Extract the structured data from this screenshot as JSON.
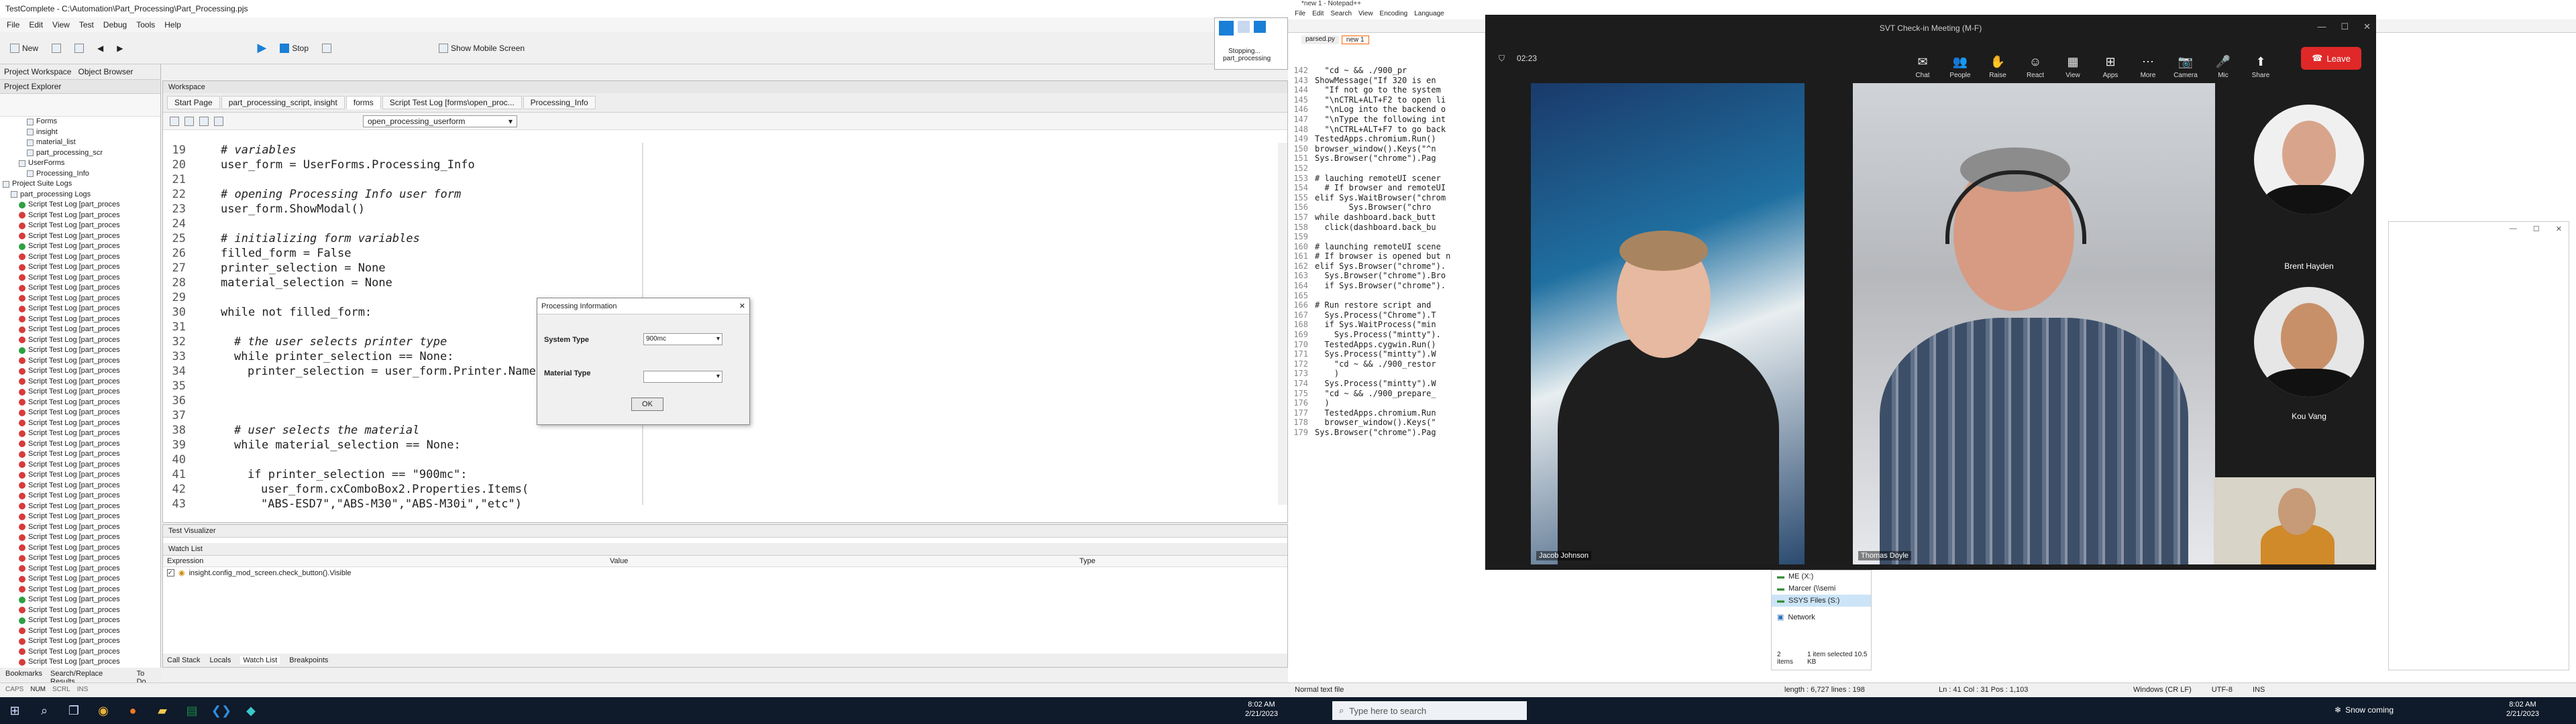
{
  "testcomplete": {
    "title": "TestComplete - C:\\Automation\\Part_Processing\\Part_Processing.pjs",
    "menu": [
      "File",
      "Edit",
      "View",
      "Test",
      "Debug",
      "Tools",
      "Help"
    ],
    "toolbar": {
      "new": "New",
      "run": "Run",
      "stop": "Stop",
      "show_mobile": "Show Mobile Screen"
    },
    "recording_badge": {
      "line1": "Stopping...",
      "line2": "part_processing"
    },
    "left_tabs": [
      "Project Workspace",
      "Object Browser"
    ],
    "project_explorer_title": "Project Explorer",
    "tree": [
      {
        "label": "Forms",
        "indent": 3,
        "status": "folder"
      },
      {
        "label": "insight",
        "indent": 3,
        "status": "folder"
      },
      {
        "label": "material_list",
        "indent": 3,
        "status": "folder"
      },
      {
        "label": "part_processing_scr",
        "indent": 3,
        "status": "folder"
      },
      {
        "label": "UserForms",
        "indent": 2,
        "status": "folder"
      },
      {
        "label": "Processing_Info",
        "indent": 3,
        "status": "folder"
      },
      {
        "label": "Project Suite Logs",
        "indent": 0,
        "status": "folder"
      },
      {
        "label": "part_processing Logs",
        "indent": 1,
        "status": "folder"
      },
      {
        "label": "Script Test Log [part_proces",
        "indent": 2,
        "status": "ok"
      },
      {
        "label": "Script Test Log [part_proces",
        "indent": 2,
        "status": "fail"
      },
      {
        "label": "Script Test Log [part_proces",
        "indent": 2,
        "status": "fail"
      },
      {
        "label": "Script Test Log [part_proces",
        "indent": 2,
        "status": "fail"
      },
      {
        "label": "Script Test Log [part_proces",
        "indent": 2,
        "status": "ok"
      },
      {
        "label": "Script Test Log [part_proces",
        "indent": 2,
        "status": "fail"
      },
      {
        "label": "Script Test Log [part_proces",
        "indent": 2,
        "status": "fail"
      },
      {
        "label": "Script Test Log [part_proces",
        "indent": 2,
        "status": "fail"
      },
      {
        "label": "Script Test Log [part_proces",
        "indent": 2,
        "status": "fail"
      },
      {
        "label": "Script Test Log [part_proces",
        "indent": 2,
        "status": "fail"
      },
      {
        "label": "Script Test Log [part_proces",
        "indent": 2,
        "status": "fail"
      },
      {
        "label": "Script Test Log [part_proces",
        "indent": 2,
        "status": "fail"
      },
      {
        "label": "Script Test Log [part_proces",
        "indent": 2,
        "status": "fail"
      },
      {
        "label": "Script Test Log [part_proces",
        "indent": 2,
        "status": "fail"
      },
      {
        "label": "Script Test Log [part_proces",
        "indent": 2,
        "status": "ok"
      },
      {
        "label": "Script Test Log [part_proces",
        "indent": 2,
        "status": "fail"
      },
      {
        "label": "Script Test Log [part_proces",
        "indent": 2,
        "status": "fail"
      },
      {
        "label": "Script Test Log [part_proces",
        "indent": 2,
        "status": "fail"
      },
      {
        "label": "Script Test Log [part_proces",
        "indent": 2,
        "status": "fail"
      },
      {
        "label": "Script Test Log [part_proces",
        "indent": 2,
        "status": "fail"
      },
      {
        "label": "Script Test Log [part_proces",
        "indent": 2,
        "status": "fail"
      },
      {
        "label": "Script Test Log [part_proces",
        "indent": 2,
        "status": "fail"
      },
      {
        "label": "Script Test Log [part_proces",
        "indent": 2,
        "status": "fail"
      },
      {
        "label": "Script Test Log [part_proces",
        "indent": 2,
        "status": "fail"
      },
      {
        "label": "Script Test Log [part_proces",
        "indent": 2,
        "status": "fail"
      },
      {
        "label": "Script Test Log [part_proces",
        "indent": 2,
        "status": "fail"
      },
      {
        "label": "Script Test Log [part_proces",
        "indent": 2,
        "status": "fail"
      },
      {
        "label": "Script Test Log [part_proces",
        "indent": 2,
        "status": "fail"
      },
      {
        "label": "Script Test Log [part_proces",
        "indent": 2,
        "status": "fail"
      },
      {
        "label": "Script Test Log [part_proces",
        "indent": 2,
        "status": "fail"
      },
      {
        "label": "Script Test Log [part_proces",
        "indent": 2,
        "status": "fail"
      },
      {
        "label": "Script Test Log [part_proces",
        "indent": 2,
        "status": "fail"
      },
      {
        "label": "Script Test Log [part_proces",
        "indent": 2,
        "status": "fail"
      },
      {
        "label": "Script Test Log [part_proces",
        "indent": 2,
        "status": "fail"
      },
      {
        "label": "Script Test Log [part_proces",
        "indent": 2,
        "status": "fail"
      },
      {
        "label": "Script Test Log [part_proces",
        "indent": 2,
        "status": "fail"
      },
      {
        "label": "Script Test Log [part_proces",
        "indent": 2,
        "status": "fail"
      },
      {
        "label": "Script Test Log [part_proces",
        "indent": 2,
        "status": "fail"
      },
      {
        "label": "Script Test Log [part_proces",
        "indent": 2,
        "status": "ok"
      },
      {
        "label": "Script Test Log [part_proces",
        "indent": 2,
        "status": "fail"
      },
      {
        "label": "Script Test Log [part_proces",
        "indent": 2,
        "status": "ok"
      },
      {
        "label": "Script Test Log [part_proces",
        "indent": 2,
        "status": "fail"
      },
      {
        "label": "Script Test Log [part_proces",
        "indent": 2,
        "status": "fail"
      },
      {
        "label": "Script Test Log [part_proces",
        "indent": 2,
        "status": "fail"
      },
      {
        "label": "Script Test Log [part_proces",
        "indent": 2,
        "status": "fail"
      },
      {
        "label": "Script Test Log [part_proces",
        "indent": 2,
        "status": "fail"
      }
    ],
    "workspace_title": "Workspace",
    "workspace_tabs": [
      "Start Page",
      "part_processing_script, insight",
      "forms",
      "Script Test Log [forms\\open_proc...",
      "Processing_Info"
    ],
    "active_tab": 2,
    "function_dropdown": "open_processing_userform",
    "code_lines": [
      {
        "n": "19",
        "t": "# variables",
        "c": "cm",
        "i": 0
      },
      {
        "n": "20",
        "t": "user_form = UserForms.Processing_Info",
        "c": "",
        "i": 0
      },
      {
        "n": "21",
        "t": "",
        "c": "",
        "i": 0
      },
      {
        "n": "22",
        "t": "# opening Processing Info user form",
        "c": "cm",
        "i": 0
      },
      {
        "n": "23",
        "t": "user_form.ShowModal()",
        "c": "",
        "i": 0
      },
      {
        "n": "24",
        "t": "",
        "c": "",
        "i": 0
      },
      {
        "n": "25",
        "t": "# initializing form variables",
        "c": "cm",
        "i": 0
      },
      {
        "n": "26",
        "t": "filled_form = False",
        "c": "",
        "i": 0
      },
      {
        "n": "27",
        "t": "printer_selection = None",
        "c": "",
        "i": 0
      },
      {
        "n": "28",
        "t": "material_selection = None",
        "c": "",
        "i": 0
      },
      {
        "n": "29",
        "t": "",
        "c": "",
        "i": 0
      },
      {
        "n": "30",
        "t": "while not filled_form:",
        "c": "kw",
        "i": 0
      },
      {
        "n": "31",
        "t": "",
        "c": "",
        "i": 0
      },
      {
        "n": "32",
        "t": "# the user selects printer type",
        "c": "cm",
        "i": 1
      },
      {
        "n": "33",
        "t": "while printer_selection == None:",
        "c": "kw",
        "i": 1
      },
      {
        "n": "34",
        "t": "printer_selection = user_form.Printer.Name",
        "c": "",
        "i": 2
      },
      {
        "n": "35",
        "t": "",
        "c": "",
        "i": 0
      },
      {
        "n": "36",
        "t": "",
        "c": "",
        "i": 0
      },
      {
        "n": "37",
        "t": "",
        "c": "",
        "i": 0
      },
      {
        "n": "38",
        "t": "# user selects the material",
        "c": "cm",
        "i": 1
      },
      {
        "n": "39",
        "t": "while material_selection == None:",
        "c": "kw",
        "i": 1
      },
      {
        "n": "40",
        "t": "",
        "c": "",
        "i": 0
      },
      {
        "n": "41",
        "t": "if printer_selection == \"900mc\":",
        "c": "kw",
        "i": 2
      },
      {
        "n": "42",
        "t": "user_form.cxComboBox2.Properties.Items(",
        "c": "",
        "i": 3
      },
      {
        "n": "43",
        "t": "\"ABS-ESD7\",\"ABS-M30\",\"ABS-M30i\",\"etc\")",
        "c": "st",
        "i": 3
      }
    ],
    "dialog": {
      "title": "Processing Information",
      "system_type_label": "System Type",
      "system_type_value": "900mc",
      "material_type_label": "Material Type",
      "material_type_value": "",
      "ok": "OK"
    },
    "test_visualizer": "Test Visualizer",
    "watch_title": "Watch List",
    "watch_cols": [
      "Expression",
      "Value",
      "Type"
    ],
    "watch_rows": [
      {
        "expr": "insight.config_mod_screen.check_button().Visible",
        "value": "",
        "type": ""
      }
    ],
    "bottom_tabs": [
      "Call Stack",
      "Locals",
      "Watch List",
      "Breakpoints"
    ],
    "footer_tabs": [
      "Bookmarks",
      "Search/Replace Results",
      "To Do"
    ],
    "status": [
      "CAPS",
      "NUM",
      "SCRL",
      "INS"
    ]
  },
  "notepad": {
    "title": "*new 1 - Notepad++",
    "menu": [
      "File",
      "Edit",
      "Search",
      "View",
      "Encoding",
      "Language"
    ],
    "tabs": [
      "parsed.py",
      "new 1"
    ],
    "code": [
      {
        "n": "142",
        "t": "  \"cd ~ && ./900_pr"
      },
      {
        "n": "143",
        "t": "ShowMessage(\"If 320 is en"
      },
      {
        "n": "144",
        "t": "  \"If not go to the system"
      },
      {
        "n": "145",
        "t": "  \"\\nCTRL+ALT+F2 to open li"
      },
      {
        "n": "146",
        "t": "  \"\\nLog into the backend o"
      },
      {
        "n": "147",
        "t": "  \"\\nType the following int"
      },
      {
        "n": "148",
        "t": "  \"\\nCTRL+ALT+F7 to go back"
      },
      {
        "n": "149",
        "t": "TestedApps.chromium.Run()"
      },
      {
        "n": "150",
        "t": "browser_window().Keys(\"^n"
      },
      {
        "n": "151",
        "t": "Sys.Browser(\"chrome\").Pag"
      },
      {
        "n": "152",
        "t": ""
      },
      {
        "n": "153",
        "t": "# lauching remoteUI scener"
      },
      {
        "n": "154",
        "t": "  # If browser and remoteUI"
      },
      {
        "n": "155",
        "t": "elif Sys.WaitBrowser(\"chrom"
      },
      {
        "n": "156",
        "t": "       Sys.Browser(\"chro"
      },
      {
        "n": "157",
        "t": "while dashboard.back_butt"
      },
      {
        "n": "158",
        "t": "  click(dashboard.back_bu"
      },
      {
        "n": "159",
        "t": ""
      },
      {
        "n": "160",
        "t": "# launching remoteUI scene"
      },
      {
        "n": "161",
        "t": "# If browser is opened but n"
      },
      {
        "n": "162",
        "t": "elif Sys.Browser(\"chrome\")."
      },
      {
        "n": "163",
        "t": "  Sys.Browser(\"chrome\").Bro"
      },
      {
        "n": "164",
        "t": "  if Sys.Browser(\"chrome\")."
      },
      {
        "n": "165",
        "t": ""
      },
      {
        "n": "166",
        "t": "# Run restore script and"
      },
      {
        "n": "167",
        "t": "  Sys.Process(\"Chrome\").T"
      },
      {
        "n": "168",
        "t": "  if Sys.WaitProcess(\"min"
      },
      {
        "n": "169",
        "t": "    Sys.Process(\"mintty\")."
      },
      {
        "n": "170",
        "t": "  TestedApps.cygwin.Run()"
      },
      {
        "n": "171",
        "t": "  Sys.Process(\"mintty\").W"
      },
      {
        "n": "172",
        "t": "    \"cd ~ && ./900_restor"
      },
      {
        "n": "173",
        "t": "    )"
      },
      {
        "n": "174",
        "t": "  Sys.Process(\"mintty\").W"
      },
      {
        "n": "175",
        "t": "  \"cd ~ && ./900_prepare_"
      },
      {
        "n": "176",
        "t": "  )"
      },
      {
        "n": "177",
        "t": "  TestedApps.chromium.Run"
      },
      {
        "n": "178",
        "t": "  browser_window().Keys(\""
      },
      {
        "n": "179",
        "t": "Sys.Browser(\"chrome\").Pag"
      }
    ],
    "status_left": "Normal text file",
    "status_length": "length : 6,727    lines : 198",
    "status_pos": "Ln : 41    Col : 31    Pos : 1,103",
    "status_eol": "Windows (CR LF)",
    "status_enc": "UTF-8",
    "status_ins": "INS"
  },
  "zoom": {
    "title": "SVT Check-in Meeting (M-F)",
    "timer": "02:23",
    "tools": [
      {
        "g": "✉",
        "l": "Chat"
      },
      {
        "g": "👥",
        "l": "People"
      },
      {
        "g": "✋",
        "l": "Raise"
      },
      {
        "g": "☺",
        "l": "React"
      },
      {
        "g": "▦",
        "l": "View"
      },
      {
        "g": "⊞",
        "l": "Apps"
      },
      {
        "g": "⋯",
        "l": "More"
      },
      {
        "g": "📷",
        "l": "Camera"
      },
      {
        "g": "🎤",
        "l": "Mic"
      },
      {
        "g": "⬆",
        "l": "Share"
      }
    ],
    "leave": "Leave",
    "participants": {
      "p1": "Jacob Johnson",
      "p2": "Thomas Doyle",
      "p3": "Brent Hayden",
      "p4": "Kou Vang"
    }
  },
  "file_tray": {
    "items": [
      "ME (X:)",
      "Marcer (\\\\semi",
      "SSYS Files (S:)",
      "Network"
    ],
    "count": "2 items",
    "selected": "1 item selected  10.5 KB"
  },
  "taskbar": {
    "search_placeholder": "Type here to search",
    "time_left": "8:02 AM",
    "date_left": "2/21/2023",
    "weather": "Snow coming",
    "time_right": "8:02 AM",
    "date_right": "2/21/2023"
  },
  "colors": {
    "ok": "#2ea043",
    "fail": "#d83b3b",
    "leave": "#e02828",
    "zoom_bg": "#1c1c1c",
    "taskbar": "#0f1a2a"
  }
}
